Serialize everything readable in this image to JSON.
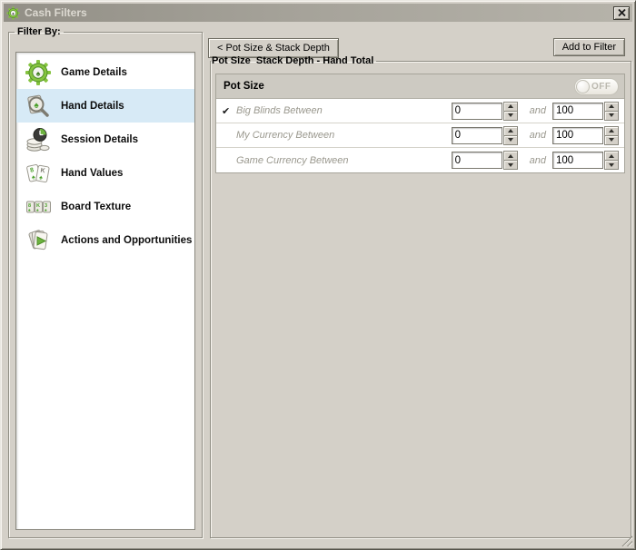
{
  "window": {
    "title": "Cash Filters"
  },
  "sidebar": {
    "label": "Filter By:",
    "items": [
      {
        "label": "Game Details",
        "icon": "gear-spade-icon",
        "selected": false
      },
      {
        "label": "Hand Details",
        "icon": "card-magnifier-icon",
        "selected": true
      },
      {
        "label": "Session Details",
        "icon": "coins-clock-icon",
        "selected": false
      },
      {
        "label": "Hand Values",
        "icon": "playing-cards-icon",
        "selected": false
      },
      {
        "label": "Board Texture",
        "icon": "board-cards-icon",
        "selected": false
      },
      {
        "label": "Actions and Opportunities",
        "icon": "action-cards-icon",
        "selected": false
      }
    ]
  },
  "main": {
    "back_button": "< Pot Size & Stack Depth",
    "add_button": "Add to Filter",
    "group_title": "Pot Size  Stack Depth - Hand Total",
    "section": {
      "title": "Pot Size",
      "toggle_label": "OFF",
      "toggle_state": "off",
      "rows": [
        {
          "check": "✔",
          "label": "Big Blinds Between",
          "from": "0",
          "conjunction": "and",
          "to": "100"
        },
        {
          "check": "",
          "label": "My Currency Between",
          "from": "0",
          "conjunction": "and",
          "to": "100"
        },
        {
          "check": "",
          "label": "Game Currency Between",
          "from": "0",
          "conjunction": "and",
          "to": "100"
        }
      ]
    }
  },
  "icons": {
    "spade": "♠",
    "hand_values_ranks": [
      "8",
      "K"
    ],
    "board_ranks": [
      "8",
      "K",
      "3"
    ]
  },
  "colors": {
    "dialog_bg": "#d4d0c8",
    "titlebar": "#a5a299",
    "selected_item_bg": "#d7eaf6",
    "panel_header_bg": "#cdcac2",
    "accent_green": "#6db33f",
    "muted_label": "#9a988e"
  }
}
